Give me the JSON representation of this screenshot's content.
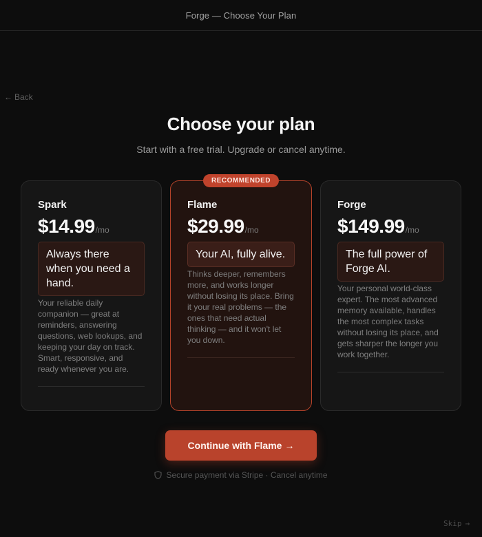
{
  "window": {
    "title": "Forge — Choose Your Plan"
  },
  "nav": {
    "back_arrow": "←",
    "back_label": "Back"
  },
  "header": {
    "title": "Choose your plan",
    "subtitle": "Start with a free trial. Upgrade or cancel anytime."
  },
  "plans": [
    {
      "name": "Spark",
      "price": "$14.99",
      "period": "/mo",
      "tagline": "Always there when you need a hand.",
      "description": "Your reliable daily companion — great at reminders, answering questions, web lookups, and keeping your day on track. Smart, responsive, and ready whenever you are."
    },
    {
      "name": "Flame",
      "price": "$29.99",
      "period": "/mo",
      "badge": "RECOMMENDED",
      "selected": true,
      "tagline": "Your AI, fully alive.",
      "description": "Thinks deeper, remembers more, and works longer without losing its place. Bring it your real problems — the ones that need actual thinking — and it won't let you down."
    },
    {
      "name": "Forge",
      "price": "$149.99",
      "period": "/mo",
      "tagline": "The full power of Forge AI.",
      "description": "Your personal world-class expert. The most advanced memory available, handles the most complex tasks without losing its place, and gets sharper the longer you work together."
    }
  ],
  "cta": {
    "label": "Continue with Flame",
    "arrow": "→"
  },
  "footer": {
    "secure_text": "Secure payment via Stripe · Cancel anytime",
    "skip_label": "Skip",
    "skip_arrow": "→"
  },
  "colors": {
    "background": "#0d0d0d",
    "accent": "#b9432c",
    "selected_border": "#b5432a"
  },
  "icons": {
    "back": "arrow-left-icon",
    "secure": "shield-icon",
    "skip": "arrow-right-icon"
  }
}
